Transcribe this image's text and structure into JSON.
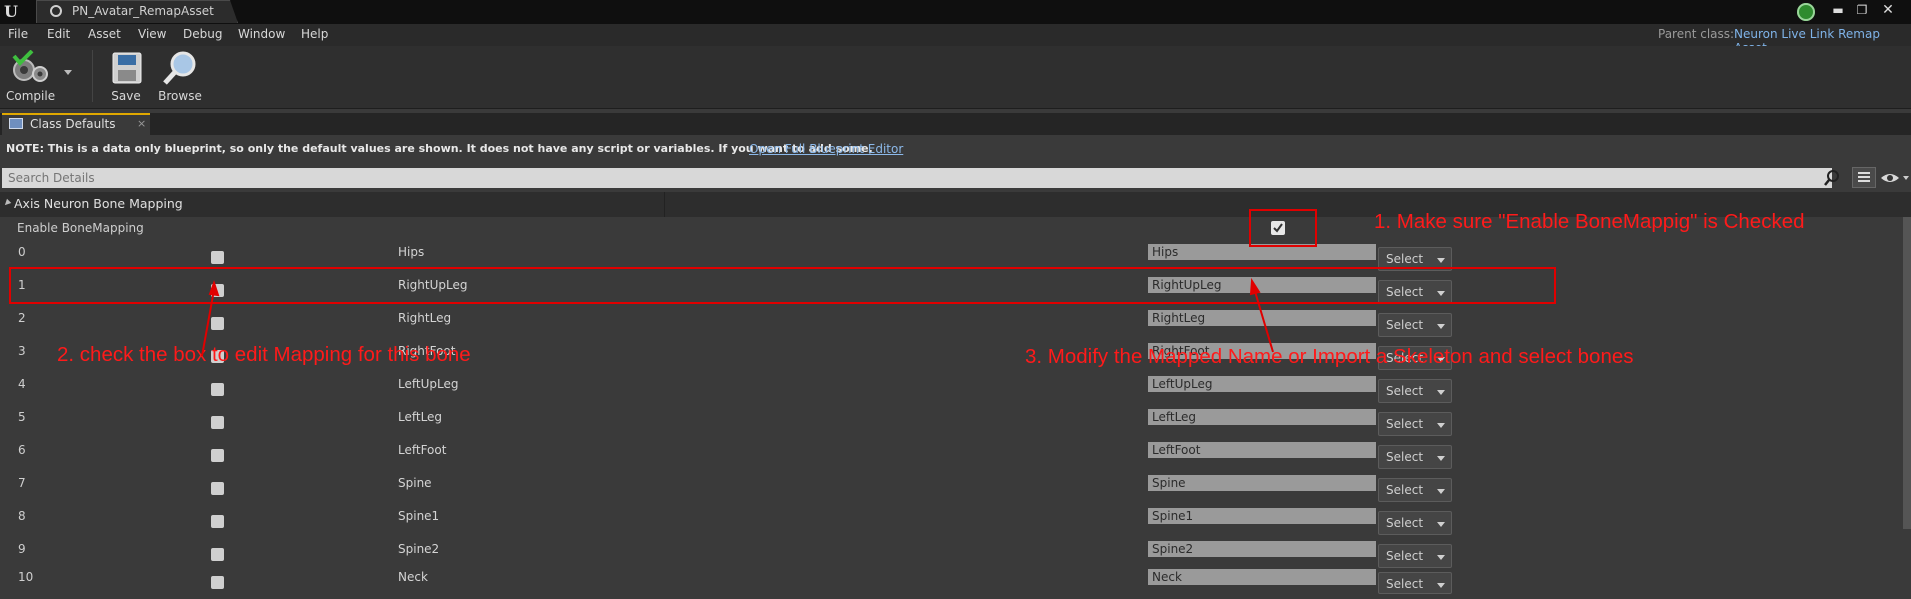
{
  "window": {
    "logo": "U",
    "tab_title": "PN_Avatar_RemapAsset",
    "status_icon": "green-status-icon",
    "controls": [
      "minimize",
      "restore",
      "close"
    ]
  },
  "menu": {
    "items": [
      "File",
      "Edit",
      "Asset",
      "View",
      "Debug",
      "Window",
      "Help"
    ],
    "parent_class_label": "Parent class:",
    "parent_class_value": "Neuron Live Link Remap Asset"
  },
  "toolbar": {
    "compile_label": "Compile",
    "save_label": "Save",
    "browse_label": "Browse"
  },
  "panel_tab": {
    "label": "Class Defaults",
    "close": "×"
  },
  "note": {
    "text": "NOTE: This is a data only blueprint, so only the default values are shown.  It does not have any script or variables.  If you want to add some,",
    "link": "Open Full Blueprint Editor"
  },
  "search": {
    "placeholder": "Search Details"
  },
  "category": {
    "label": "Axis Neuron Bone Mapping",
    "enable_label": "Enable BoneMapping",
    "enable_checked": true
  },
  "rows": [
    {
      "index": "0",
      "bone": "Hips",
      "mapped": "Hips",
      "select": "Select",
      "checked": false
    },
    {
      "index": "1",
      "bone": "RightUpLeg",
      "mapped": "RightUpLeg",
      "select": "Select",
      "checked": false
    },
    {
      "index": "2",
      "bone": "RightLeg",
      "mapped": "RightLeg",
      "select": "Select",
      "checked": false
    },
    {
      "index": "3",
      "bone": "RightFoot",
      "mapped": "RightFoot",
      "select": "Select",
      "checked": false
    },
    {
      "index": "4",
      "bone": "LeftUpLeg",
      "mapped": "LeftUpLeg",
      "select": "Select",
      "checked": false
    },
    {
      "index": "5",
      "bone": "LeftLeg",
      "mapped": "LeftLeg",
      "select": "Select",
      "checked": false
    },
    {
      "index": "6",
      "bone": "LeftFoot",
      "mapped": "LeftFoot",
      "select": "Select",
      "checked": false
    },
    {
      "index": "7",
      "bone": "Spine",
      "mapped": "Spine",
      "select": "Select",
      "checked": false
    },
    {
      "index": "8",
      "bone": "Spine1",
      "mapped": "Spine1",
      "select": "Select",
      "checked": false
    },
    {
      "index": "9",
      "bone": "Spine2",
      "mapped": "Spine2",
      "select": "Select",
      "checked": false
    },
    {
      "index": "10",
      "bone": "Neck",
      "mapped": "Neck",
      "select": "Select",
      "checked": false
    }
  ],
  "annotations": {
    "note1": "1. Make sure \"Enable BoneMappig\" is Checked",
    "note2": "2. check the box to edit Mapping for this bone",
    "note3": "3. Modify the Mapped Name or Import a Skeleton and select bones",
    "color": "#ff1a1a"
  },
  "colors": {
    "background": "#3a3a3a",
    "accent_tab": "#e0a800",
    "link": "#8cb9ea"
  }
}
